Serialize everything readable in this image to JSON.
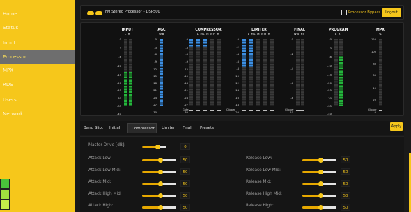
{
  "sidebar": {
    "items": [
      {
        "label": "Home"
      },
      {
        "label": "Status"
      },
      {
        "label": "Input"
      },
      {
        "label": "Processor"
      },
      {
        "label": "MPX"
      },
      {
        "label": "RDS"
      },
      {
        "label": "Users"
      },
      {
        "label": "Network"
      }
    ]
  },
  "header": {
    "title": "FM Stereo Processor – DSP500",
    "bypass_label": "Processor Bypass",
    "logout_label": "Logout"
  },
  "meters": {
    "input": {
      "title": "INPUT",
      "sub": [
        "L",
        "R"
      ],
      "scale": [
        "0",
        "-3",
        "-6",
        "-10",
        "-15",
        "-20",
        "-25",
        "-30",
        "-35",
        "-40"
      ]
    },
    "agc": {
      "title": "AGC",
      "sub": [
        "WB"
      ],
      "scale": [
        "0",
        "-3",
        "-6",
        "-9",
        "-12",
        "-15",
        "-18",
        "-21",
        "-24",
        "-27",
        "-30"
      ]
    },
    "compressor": {
      "title": "COMPRESSOR",
      "sub": [
        "L",
        "ML",
        "M",
        "MH",
        "H"
      ],
      "scale": [
        "0",
        "-3",
        "-6",
        "-9",
        "-12",
        "-15",
        "-18",
        "-21",
        "-24",
        "-27",
        "-30"
      ],
      "footer": "Gate"
    },
    "limiter": {
      "title": "LIMITER",
      "sub": [
        "L",
        "ML",
        "M",
        "MH",
        "H"
      ],
      "scale": [
        "0",
        "-2",
        "-4",
        "-6",
        "-8",
        "-10",
        "-12",
        "-14",
        "-16",
        "-18",
        "-20"
      ],
      "footer": "Clipper"
    },
    "final": {
      "title": "FINAL",
      "sub": [
        "WB",
        "HF"
      ],
      "scale": [
        "0",
        "-2",
        "-4",
        "-6",
        "-8",
        "-10"
      ],
      "footer": "Clipper"
    },
    "program": {
      "title": "PROGRAM",
      "sub": [
        "L",
        "R"
      ],
      "scale": [
        "0",
        "-3",
        "-6",
        "-10",
        "-15",
        "-20",
        "-25",
        "-30",
        "-35",
        "-40"
      ]
    },
    "mpx": {
      "title": "MPX",
      "sub": [
        "%"
      ],
      "scale": [
        "120",
        "100",
        "80",
        "60",
        "40",
        "20",
        "0"
      ],
      "footer": "Clipper"
    }
  },
  "tabs": {
    "items": [
      "Band Slipt",
      "Initial",
      "Compressor",
      "Limiter",
      "Final",
      "Presets"
    ],
    "active": "Compressor",
    "apply_label": "Apply"
  },
  "form": {
    "left": [
      {
        "label": "Master Drive [dB]:",
        "value": "0",
        "percent": 60
      },
      {
        "label": "Attack Low:",
        "value": "50",
        "percent": 50
      },
      {
        "label": "Attack Low Mid:",
        "value": "50",
        "percent": 50
      },
      {
        "label": "Attack Mid:",
        "value": "50",
        "percent": 50
      },
      {
        "label": "Attack High Mid:",
        "value": "50",
        "percent": 50
      },
      {
        "label": "Attack High:",
        "value": "50",
        "percent": 50
      }
    ],
    "right": [
      {
        "label": "Release Low:",
        "value": "50",
        "percent": 50
      },
      {
        "label": "Release Low Mid:",
        "value": "50",
        "percent": 50
      },
      {
        "label": "Release Mid:",
        "value": "50",
        "percent": 50
      },
      {
        "label": "Release High Mid:",
        "value": "50",
        "percent": 50
      },
      {
        "label": "Release High:",
        "value": "50",
        "percent": 50
      }
    ]
  },
  "colors": {
    "accent": "#f6c71b",
    "meter_green": "#24b53c",
    "meter_blue": "#3c8fe3",
    "panel_bg": "#111111"
  }
}
